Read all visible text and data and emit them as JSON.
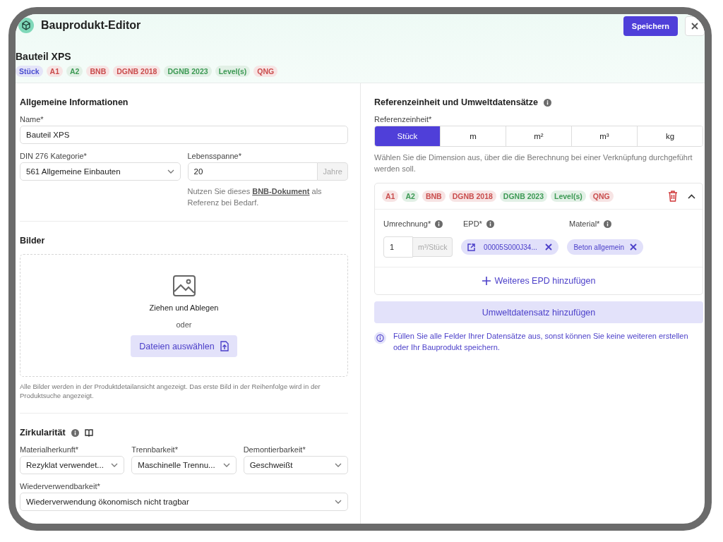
{
  "header": {
    "title": "Bauprodukt-Editor",
    "save_button": "Speichern"
  },
  "product": {
    "name": "Bauteil XPS",
    "tags": [
      {
        "label": "Stück",
        "color": "#4a4ed0"
      },
      {
        "label": "A1",
        "color": "#c94c4c"
      },
      {
        "label": "A2",
        "color": "#3d9a55"
      },
      {
        "label": "BNB",
        "color": "#c94c4c"
      },
      {
        "label": "DGNB 2018",
        "color": "#c94c4c"
      },
      {
        "label": "DGNB 2023",
        "color": "#3d9a55"
      },
      {
        "label": "Level(s)",
        "color": "#3d9a55"
      },
      {
        "label": "QNG",
        "color": "#c94c4c"
      }
    ]
  },
  "general": {
    "heading": "Allgemeine Informationen",
    "name_label": "Name*",
    "name_value": "Bauteil XPS",
    "category_label": "DIN 276 Kategorie*",
    "category_value": "561 Allgemeine Einbauten",
    "lifespan_label": "Lebensspanne*",
    "lifespan_value": "20",
    "lifespan_unit": "Jahre",
    "hint_before": "Nutzen Sie dieses ",
    "hint_link": "BNB-Dokument",
    "hint_after": " als Referenz bei Bedarf."
  },
  "images": {
    "heading": "Bilder",
    "drop_text": "Ziehen und Ablegen",
    "or_text": "oder",
    "choose_button": "Dateien auswählen",
    "note": "Alle Bilder werden in der Produktdetailansicht angezeigt. Das erste Bild in der Reihenfolge wird in der Produktsuche angezeigt."
  },
  "circularity": {
    "heading": "Zirkularität",
    "fields": [
      {
        "label": "Materialherkunft*",
        "value": "Rezyklat verwendet..."
      },
      {
        "label": "Trennbarkeit*",
        "value": "Maschinelle Trennu..."
      },
      {
        "label": "Demontierbarkeit*",
        "value": "Geschweißt"
      }
    ],
    "reuse": {
      "label": "Wiederverwendbarkeit*",
      "value": "Wiederverwendung ökonomisch nicht tragbar"
    }
  },
  "reference": {
    "heading": "Referenzeinheit und Umweltdatensätze",
    "unit_label": "Referenzeinheit*",
    "units": [
      {
        "label": "Stück",
        "selected": true
      },
      {
        "label": "m",
        "selected": false
      },
      {
        "label": "m²",
        "selected": false
      },
      {
        "label": "m³",
        "selected": false
      },
      {
        "label": "kg",
        "selected": false
      }
    ],
    "hint": "Wählen Sie die Dimension aus, über die die Berechnung bei einer Verknüpfung durchgeführt werden soll.",
    "dataset": {
      "expanded": true,
      "tags": [
        {
          "label": "A1",
          "color": "#c94c4c"
        },
        {
          "label": "A2",
          "color": "#3d9a55"
        },
        {
          "label": "BNB",
          "color": "#c94c4c"
        },
        {
          "label": "DGNB 2018",
          "color": "#c94c4c"
        },
        {
          "label": "DGNB 2023",
          "color": "#3d9a55"
        },
        {
          "label": "Level(s)",
          "color": "#3d9a55"
        },
        {
          "label": "QNG",
          "color": "#c94c4c"
        }
      ],
      "conversion_label": "Umrechnung*",
      "conversion_value": "1",
      "conversion_unit": "m³/Stück",
      "epd_label": "EPD*",
      "epd_chip": "00005S000J34...",
      "material_label": "Material*",
      "material_chip": "Beton allgemein",
      "add_epd": "Weiteres EPD hinzufügen"
    },
    "add_dataset": "Umweltdatensatz hinzufügen",
    "notice": "Füllen Sie alle Felder Ihrer Datensätze aus, sonst können Sie keine weiteren erstellen oder Ihr Bauprodukt speichern."
  }
}
